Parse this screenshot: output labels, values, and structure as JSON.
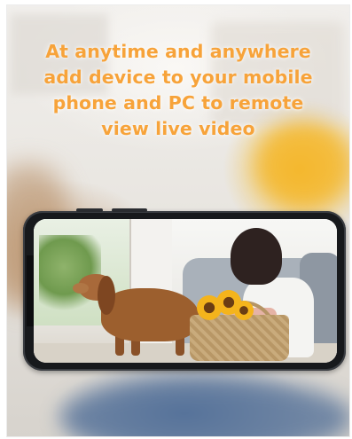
{
  "promo": {
    "headline_lines": [
      "At anytime and anywhere",
      "add device to your mobile",
      "phone and PC to remote",
      "view live video"
    ]
  },
  "colors": {
    "headline": "#f7a33a",
    "phone_frame": "#17191c"
  },
  "icons": [
    "phone-mockup"
  ]
}
